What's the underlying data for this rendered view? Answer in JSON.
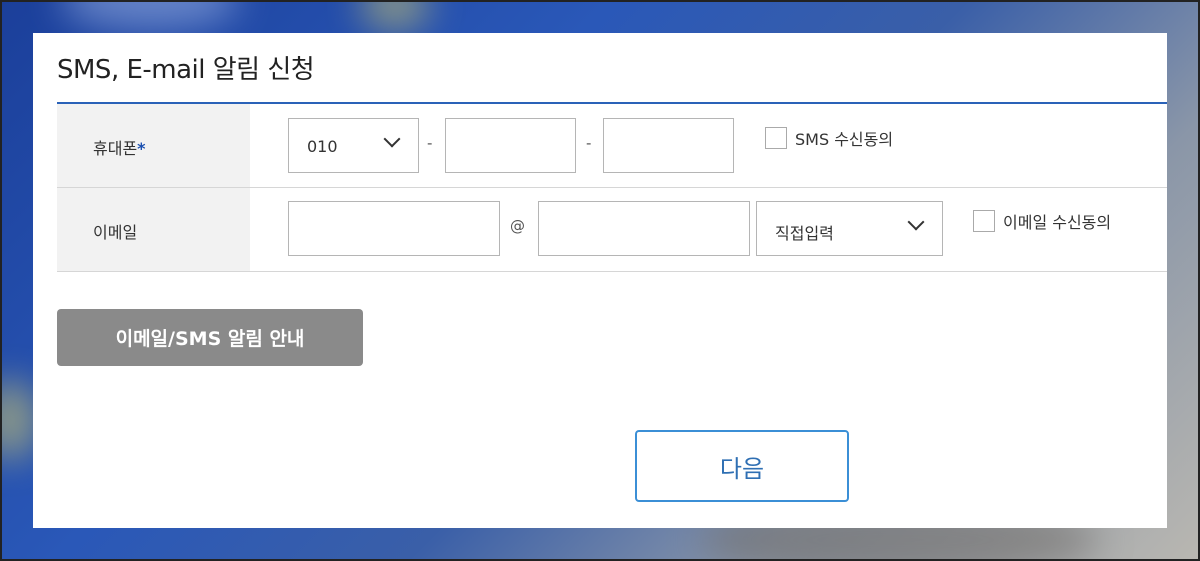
{
  "dialog": {
    "title": "SMS, E-mail 알림 신청"
  },
  "phone_row": {
    "label": "휴대폰",
    "required_mark": "*",
    "prefix_select": "010",
    "separator": "-",
    "middle_value": "",
    "last_value": "",
    "consent_label": "SMS 수신동의"
  },
  "email_row": {
    "label": "이메일",
    "local_value": "",
    "at_symbol": "@",
    "domain_value": "",
    "domain_select": "직접입력",
    "consent_label": "이메일 수신동의"
  },
  "notice_button_label": "이메일/SMS 알림 안내",
  "next_button_label": "다음",
  "colors": {
    "accent_rule": "#2a62b8",
    "required_star": "#1a4fb0",
    "notice_button_bg": "#8a8a8a",
    "next_button_border": "#3b8fd6",
    "next_button_text": "#2f6fb3"
  }
}
